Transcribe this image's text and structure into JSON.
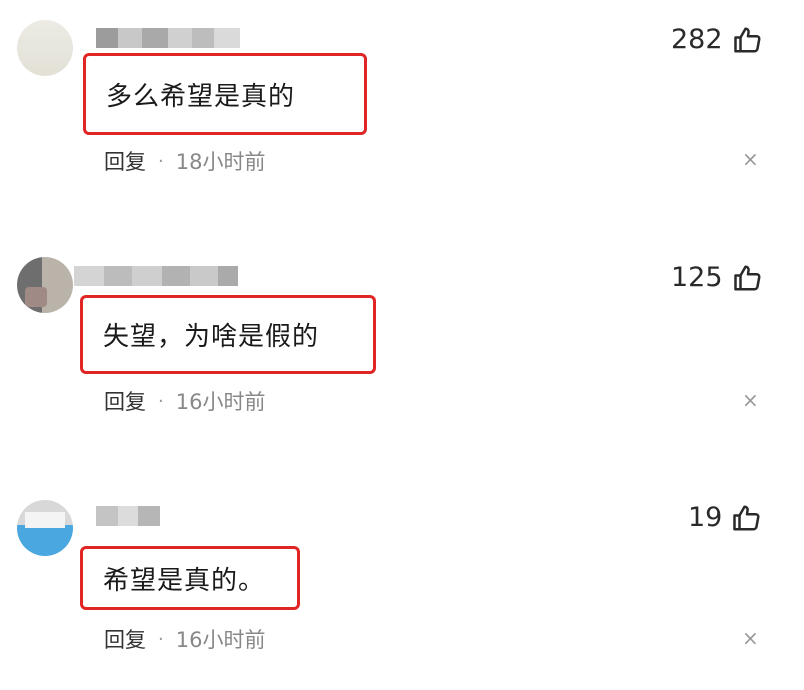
{
  "comments": [
    {
      "text": "多么希望是真的",
      "likes": "282",
      "reply_label": "回复",
      "separator": "·",
      "time": "18小时前",
      "close_glyph": "×"
    },
    {
      "text": "失望，为啥是假的",
      "likes": "125",
      "reply_label": "回复",
      "separator": "·",
      "time": "16小时前",
      "close_glyph": "×"
    },
    {
      "text": "希望是真的。",
      "likes": "19",
      "reply_label": "回复",
      "separator": "·",
      "time": "16小时前",
      "close_glyph": "×"
    }
  ],
  "icons": {
    "like": "thumbs-up-icon",
    "close": "close-icon"
  },
  "colors": {
    "highlight_box": "#e02525",
    "meta_text": "#888888"
  }
}
